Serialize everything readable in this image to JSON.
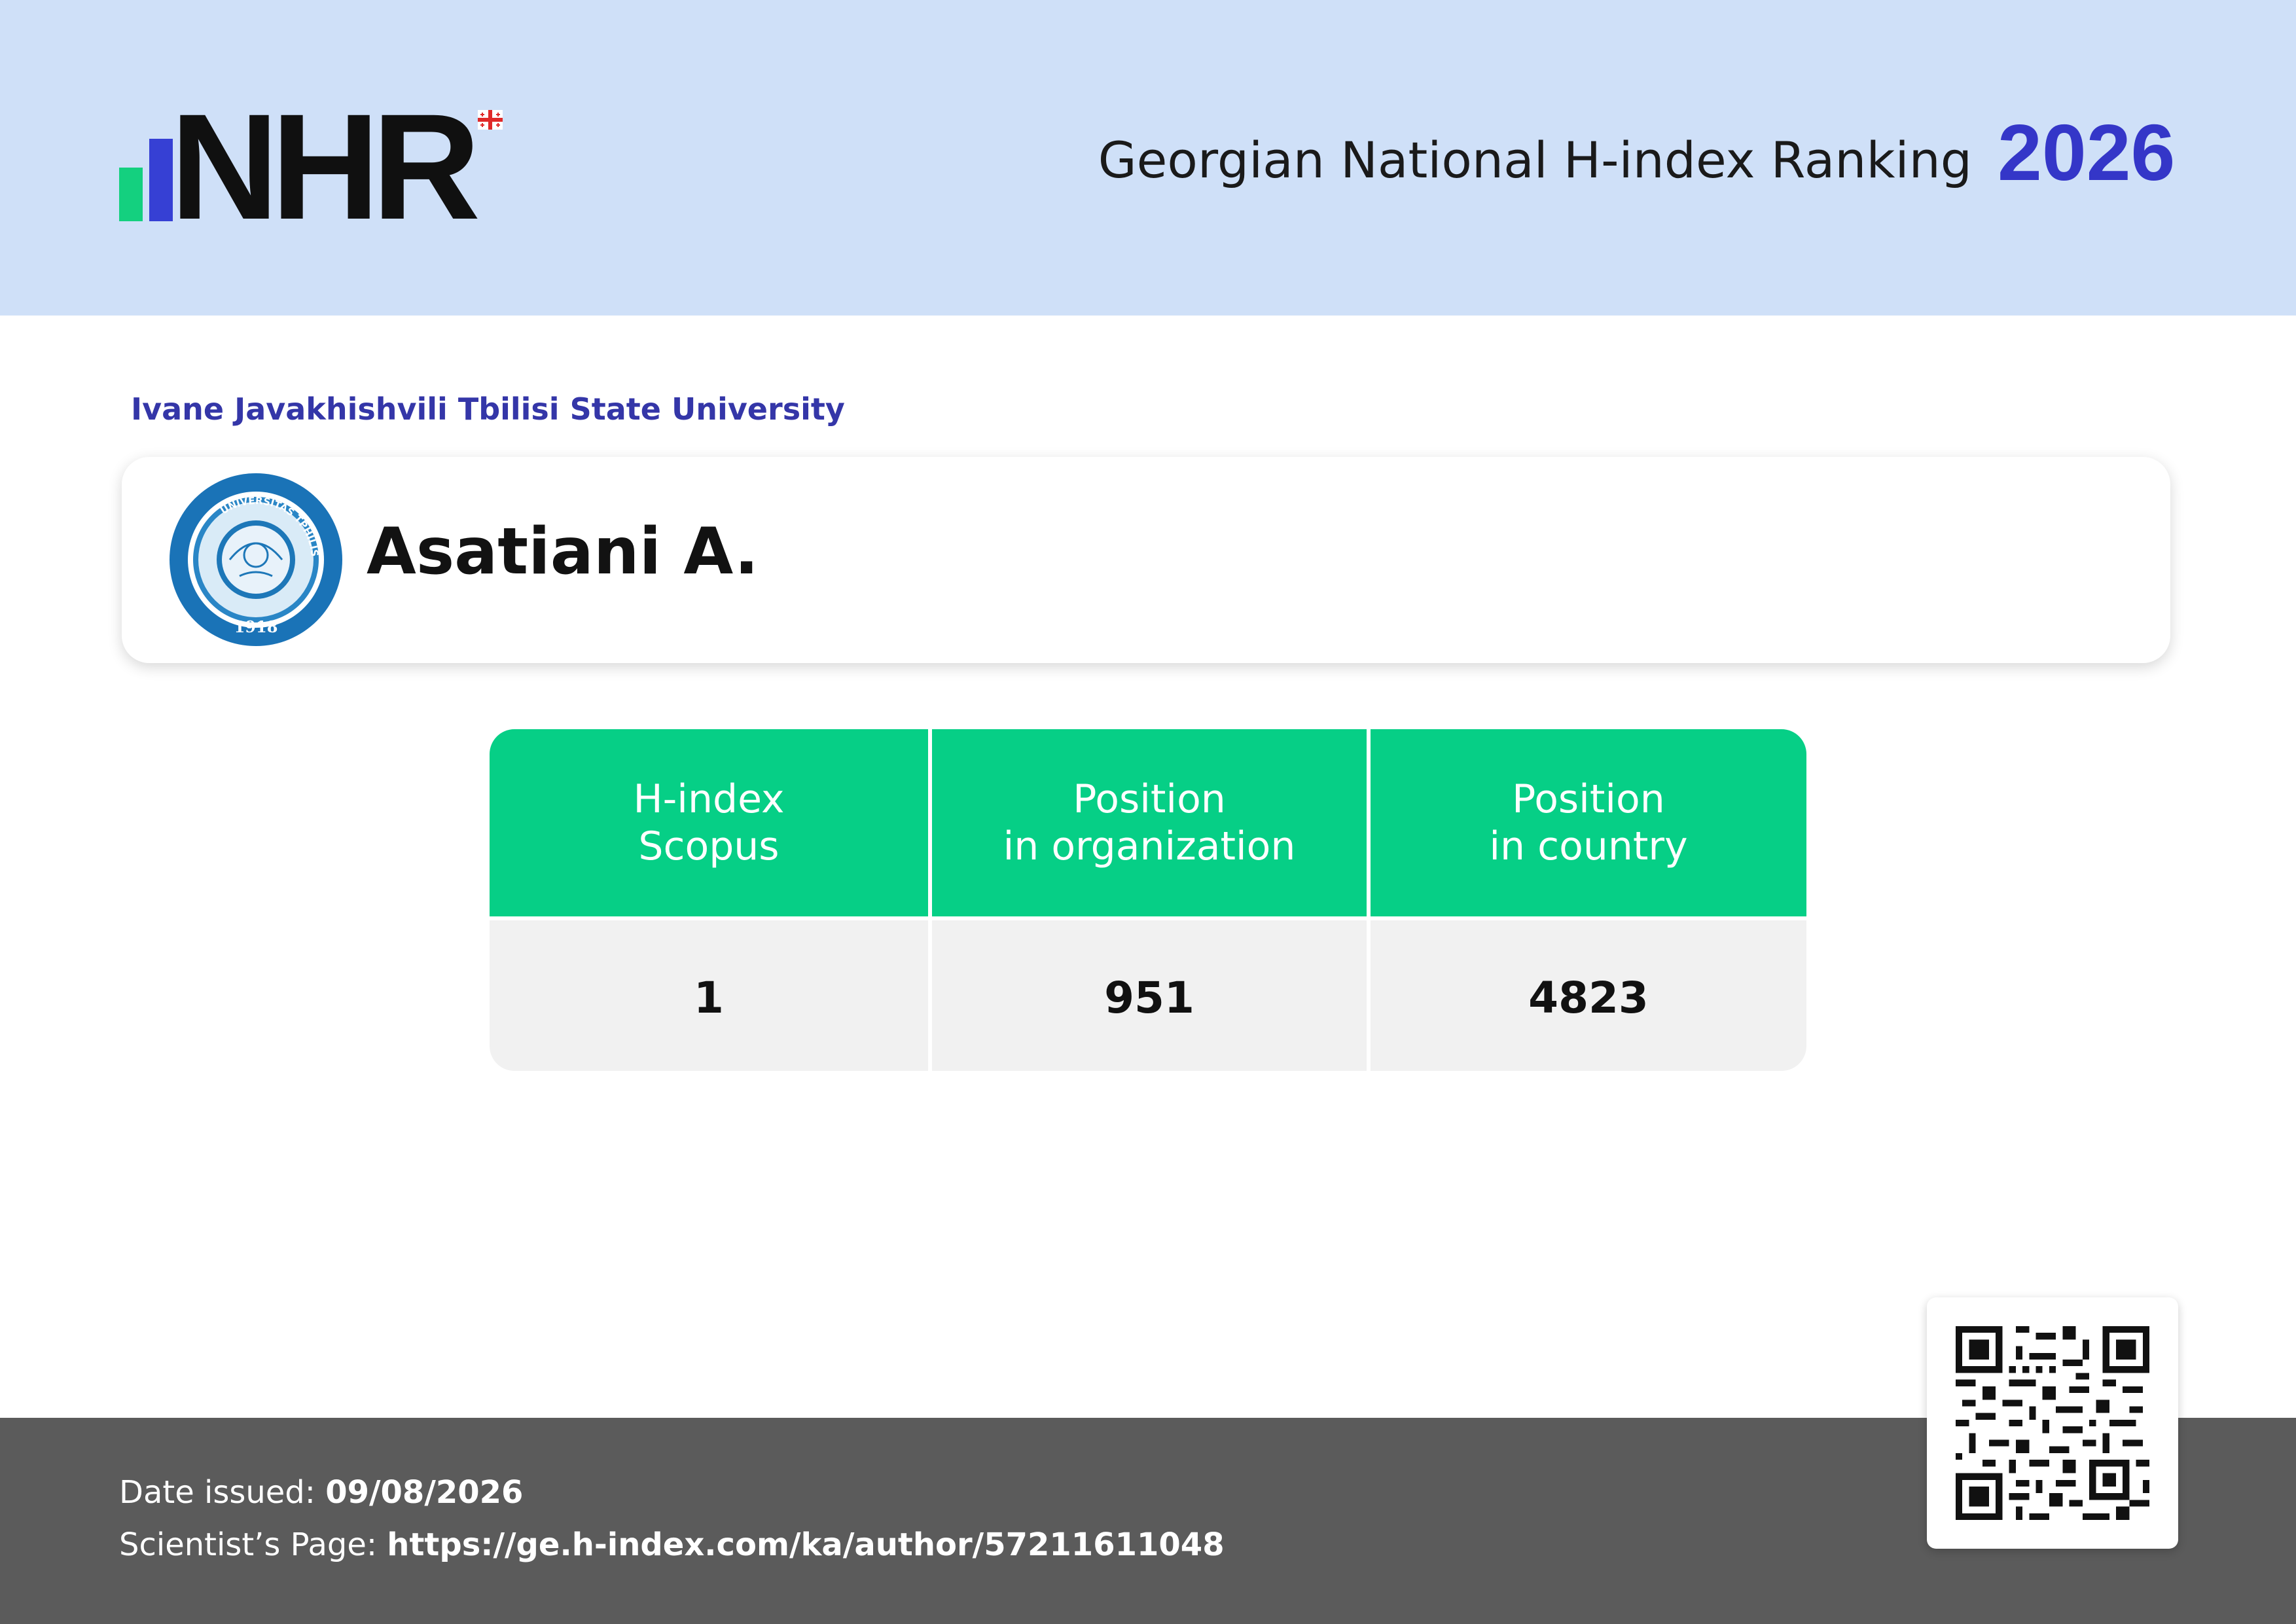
{
  "header": {
    "logo_text": "NHR",
    "title": "Georgian National H-index Ranking",
    "year": "2026"
  },
  "organization": "Ivane Javakhishvili Tbilisi State University",
  "seal": {
    "top_text": "UNIVERSITAS TPHILISENSIS",
    "year": "1918"
  },
  "scientist": {
    "name": "Asatiani A."
  },
  "stats": [
    {
      "label_line1": "H-index",
      "label_line2": "Scopus",
      "value": "1"
    },
    {
      "label_line1": "Position",
      "label_line2": "in organization",
      "value": "951"
    },
    {
      "label_line1": "Position",
      "label_line2": "in country",
      "value": "4823"
    }
  ],
  "footer": {
    "date_label": "Date issued:",
    "date_value": "09/08/2026",
    "page_label": "Scientist’s Page:",
    "page_url": "https://ge.h-index.com/ka/author/57211611048"
  },
  "colors": {
    "header_bg": "#cfe0f8",
    "accent_blue": "#3436c8",
    "accent_green": "#06cf86",
    "footer_bg": "#5b5b5b"
  }
}
